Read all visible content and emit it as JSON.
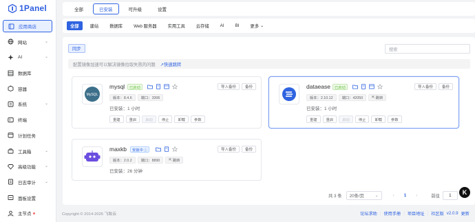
{
  "brand": {
    "name": "1Panel"
  },
  "sidebar": {
    "items": [
      {
        "label": "应用商店",
        "icon": "store-icon",
        "active": true,
        "chevron": false
      },
      {
        "label": "网站",
        "icon": "globe-icon",
        "chevron": true
      },
      {
        "label": "AI",
        "icon": "ai-icon",
        "chevron": true
      },
      {
        "label": "数据库",
        "icon": "database-icon",
        "chevron": false
      },
      {
        "label": "容器",
        "icon": "container-icon",
        "chevron": false
      },
      {
        "label": "系统",
        "icon": "system-icon",
        "chevron": true
      },
      {
        "label": "终端",
        "icon": "terminal-icon",
        "chevron": false
      },
      {
        "label": "计划任务",
        "icon": "clock-icon",
        "chevron": false
      },
      {
        "label": "工具箱",
        "icon": "toolbox-icon",
        "chevron": true
      },
      {
        "label": "高级功能",
        "icon": "diamond-icon",
        "chevron": true
      },
      {
        "label": "日志审计",
        "icon": "log-icon",
        "chevron": true
      },
      {
        "label": "面板设置",
        "icon": "settings-icon",
        "chevron": false
      },
      {
        "label": "主节点",
        "icon": "user-icon",
        "chevron": false,
        "dot": true
      }
    ]
  },
  "top_tabs": [
    {
      "label": "全部",
      "active": false
    },
    {
      "label": "已安装",
      "active": true
    },
    {
      "label": "可升级",
      "active": false
    },
    {
      "label": "设置",
      "active": false
    }
  ],
  "categories": [
    {
      "label": "全部",
      "active": true
    },
    {
      "label": "建站"
    },
    {
      "label": "数据库"
    },
    {
      "label": "Web 服务器"
    },
    {
      "label": "实用工具"
    },
    {
      "label": "云存储"
    },
    {
      "label": "AI"
    },
    {
      "label": "BI"
    },
    {
      "label": "更多"
    }
  ],
  "toolbar": {
    "sync_label": "同步",
    "search_placeholder": "搜索"
  },
  "notice": {
    "text": "配置镜像加速可以解决镜像拉取失败的问题",
    "link": "快速跳转"
  },
  "apps": [
    {
      "name": "mysql",
      "status": "已启动",
      "status_type": "ok",
      "version_label": "版本：8.4.6",
      "port_label": "端口：3306",
      "installed": "已安装：1 小时",
      "import_label": "导入备份",
      "backup_label": "备份",
      "actions": [
        "重建",
        "重启",
        "启动",
        "停止",
        "卸载",
        "参数"
      ]
    },
    {
      "name": "dataease",
      "status": "已启动",
      "status_type": "ok",
      "version_label": "版本：2.10.12",
      "port_label": "端口：42050",
      "jump_label": "跳转",
      "installed": "已安装：1 小时",
      "import_label": "导入备份",
      "backup_label": "备份",
      "actions": [
        "重建",
        "重启",
        "启动",
        "停止",
        "卸载",
        "参数"
      ]
    },
    {
      "name": "maxkb",
      "status": "安装中",
      "status_type": "inst",
      "version_label": "版本：2.0.2",
      "port_label": "端口：8890",
      "jump_label": "跳转",
      "installed": "已安装：26 分钟",
      "import_label": "导入备份",
      "backup_label": "备份"
    }
  ],
  "pagination": {
    "total": "共 3 条",
    "page_size": "20条/页",
    "current": "1",
    "goto_label": "前往",
    "goto_value": "1"
  },
  "footer": {
    "copyright": "Copyright © 2014-2025 飞致云",
    "links": [
      "论坛求助",
      "使用手册",
      "项目地址",
      "社区版"
    ],
    "version": "v2.0.9",
    "update": "更新"
  },
  "colors": {
    "accent": "#2f63e0",
    "success": "#67c23a",
    "mysql_bg": "#3d6f8a",
    "dataease_bg": "#2f63e0",
    "maxkb_bg": "#6b4fe0"
  }
}
